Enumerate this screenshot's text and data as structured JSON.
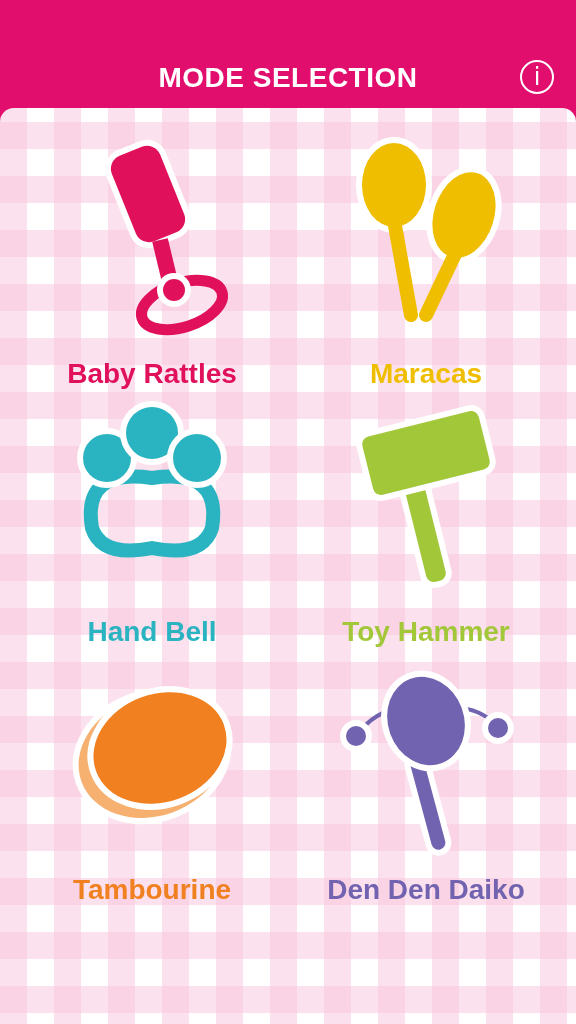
{
  "header": {
    "title": "MODE SELECTION",
    "info_button": "i"
  },
  "modes": [
    {
      "kind": "rattle",
      "label": "Baby Rattles",
      "color": "#e0105a"
    },
    {
      "kind": "maracas",
      "label": "Maracas",
      "color": "#f0be00"
    },
    {
      "kind": "handbell",
      "label": "Hand Bell",
      "color": "#2ab3c0"
    },
    {
      "kind": "hammer",
      "label": "Toy Hammer",
      "color": "#a2c83a"
    },
    {
      "kind": "tambourine",
      "label": "Tambourine",
      "color": "#f08020"
    },
    {
      "kind": "dendendaiko",
      "label": "Den Den Daiko",
      "color": "#7263b0"
    }
  ]
}
